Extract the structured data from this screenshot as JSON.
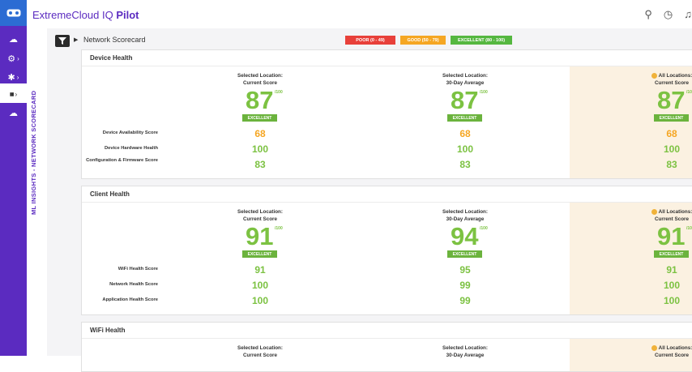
{
  "app": {
    "title_prefix": "ExtremeCloud IQ ",
    "title_bold": "Pilot"
  },
  "sidebar": {
    "items": [
      {
        "icon": "cloud-upload-icon",
        "glyph": "☁",
        "active": false
      },
      {
        "icon": "gear-icon",
        "glyph": "⚙",
        "chevron": "›",
        "active": false
      },
      {
        "icon": "puzzle-icon",
        "glyph": "✱",
        "chevron": "›",
        "active": false
      },
      {
        "icon": "bar-chart-icon",
        "glyph": "▮▮",
        "chevron": "›",
        "active": true
      },
      {
        "icon": "cloud-icon",
        "glyph": "☁",
        "active": false
      }
    ]
  },
  "topbar": {
    "icons": [
      {
        "name": "search-icon",
        "glyph": "⚲"
      },
      {
        "name": "clock-icon",
        "glyph": "◷"
      },
      {
        "name": "bell-icon",
        "glyph": "♫"
      }
    ]
  },
  "side_panel": {
    "title": "ML INSIGHTS - NETWORK SCORECARD"
  },
  "scorecard": {
    "title": "Network Scorecard"
  },
  "legend": [
    {
      "label": "POOR (0 - 49)",
      "color": "#e8403a"
    },
    {
      "label": "GOOD (50 - 79)",
      "color": "#f5a623"
    },
    {
      "label": "EXCELLENT (80 - 100)",
      "color": "#55b740"
    }
  ],
  "columns": [
    {
      "line1": "Selected Location:",
      "line2": "Current Score"
    },
    {
      "line1": "Selected Location:",
      "line2": "30-Day Average"
    },
    {
      "line1": "All Locations:",
      "line2": "Current Score"
    }
  ],
  "out_of": "/100",
  "badge_label": "EXCELLENT",
  "colors": {
    "excellent": "#7cc242",
    "good": "#f5a623"
  },
  "sections": [
    {
      "title": "Device Health",
      "scores": [
        "87",
        "87",
        "87"
      ],
      "rows": [
        {
          "label": "Device Availability Score",
          "values": [
            "68",
            "68",
            "68"
          ],
          "status": "good"
        },
        {
          "label": "Device Hardware Health",
          "values": [
            "100",
            "100",
            "100"
          ],
          "status": "excellent"
        },
        {
          "label": "Configuration & Firmware Score",
          "values": [
            "83",
            "83",
            "83"
          ],
          "status": "excellent"
        }
      ]
    },
    {
      "title": "Client Health",
      "scores": [
        "91",
        "94",
        "91"
      ],
      "rows": [
        {
          "label": "WiFi Health Score",
          "values": [
            "91",
            "95",
            "91"
          ],
          "status": "excellent"
        },
        {
          "label": "Network Health Score",
          "values": [
            "100",
            "99",
            "100"
          ],
          "status": "excellent"
        },
        {
          "label": "Application Health Score",
          "values": [
            "100",
            "99",
            "100"
          ],
          "status": "excellent"
        }
      ]
    },
    {
      "title": "WiFi Health",
      "scores": [],
      "rows": []
    }
  ]
}
